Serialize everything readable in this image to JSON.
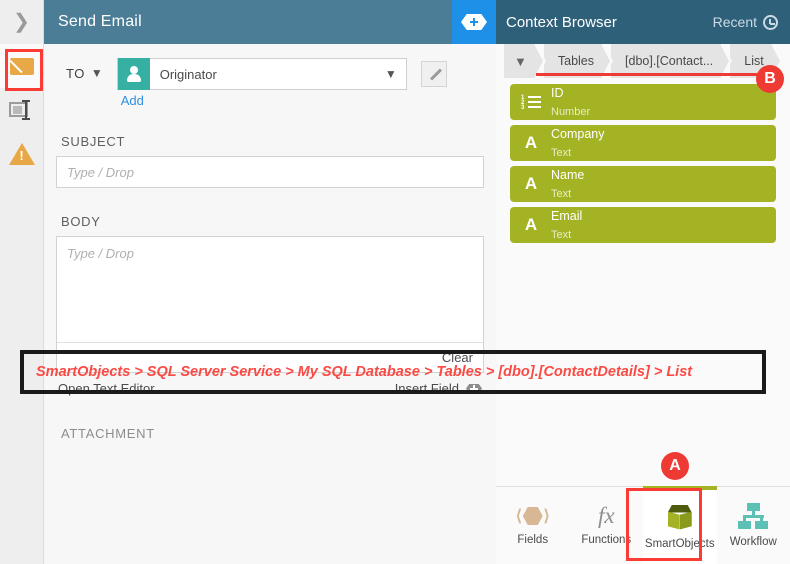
{
  "rail": {
    "expand_icon": "chevron-right-icon",
    "items": [
      {
        "icon": "envelope-icon",
        "name": "email-step",
        "selected": true
      },
      {
        "icon": "text-input-icon",
        "name": "text-step",
        "selected": false
      },
      {
        "icon": "warning-triangle-icon",
        "name": "warning-step",
        "selected": false
      }
    ]
  },
  "main": {
    "title": "Send Email",
    "add_button_icon": "hexagon-plus-icon",
    "to": {
      "label": "TO",
      "chevron": "chevron-down-icon",
      "avatar_icon": "person-icon",
      "value": "Originator",
      "dropdown_icon": "chevron-down-icon",
      "add_link": "Add",
      "edit_icon": "pencil-icon"
    },
    "subject": {
      "label": "SUBJECT",
      "placeholder": "Type / Drop",
      "value": ""
    },
    "body": {
      "label": "BODY",
      "placeholder": "Type / Drop",
      "value": "",
      "clear_label": "Clear"
    },
    "open_text_editor": "Open Text Editor",
    "insert_field": "Insert Field",
    "insert_field_icon": "hexagon-plus-icon",
    "attachment_label": "ATTACHMENT"
  },
  "context_browser": {
    "title": "Context Browser",
    "recent_label": "Recent",
    "recent_icon": "clock-icon",
    "breadcrumb": {
      "collapse_icon": "chevron-down-icon",
      "items": [
        "Tables",
        "[dbo].[Contact...",
        "List"
      ]
    },
    "fields": [
      {
        "name": "ID",
        "type": "Number",
        "icon": "number-list-icon"
      },
      {
        "name": "Company",
        "type": "Text",
        "icon": "letter-a-icon"
      },
      {
        "name": "Name",
        "type": "Text",
        "icon": "letter-a-icon"
      },
      {
        "name": "Email",
        "type": "Text",
        "icon": "letter-a-icon"
      }
    ],
    "tabs": [
      {
        "label": "Fields",
        "icon": "hexagon-brackets-icon",
        "selected": false
      },
      {
        "label": "Functions",
        "icon": "fx-icon",
        "selected": false
      },
      {
        "label": "SmartObjects",
        "icon": "cube-icon",
        "selected": true
      },
      {
        "label": "Workflow",
        "icon": "hierarchy-icon",
        "selected": false
      }
    ]
  },
  "annotations": {
    "path_note": "SmartObjects > SQL Server Service > My SQL Database > Tables > [dbo].[ContactDetails] > List",
    "badge_a": "A",
    "badge_b": "B"
  },
  "colors": {
    "main_header": "#4b7e96",
    "panel_header": "#2f6079",
    "accent_blue": "#1e90e8",
    "olive": "#a3b323",
    "teal": "#35b0a2",
    "orange": "#e8a846",
    "highlight_red": "#fb3b34",
    "annotation_red": "#fb4a44"
  }
}
